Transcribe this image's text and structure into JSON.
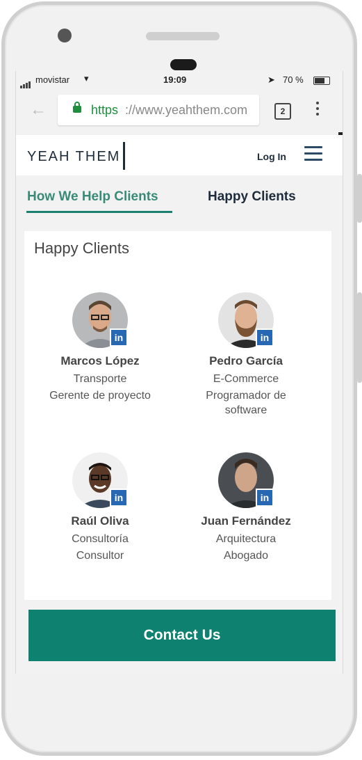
{
  "status_bar": {
    "carrier": "movistar",
    "time": "19:09",
    "battery": "70 %"
  },
  "browser": {
    "url_scheme": "https",
    "url_rest": "://www.yeahthem.com",
    "tab_count": "2"
  },
  "header": {
    "logo": "YEAH THEM",
    "login_label": "Log In"
  },
  "tabs": [
    {
      "label": "How We Help Clients",
      "active": true
    },
    {
      "label": "Happy Clients",
      "active": false
    }
  ],
  "section": {
    "title": "Happy Clients"
  },
  "clients": [
    {
      "name": "Marcos López",
      "industry": "Transporte",
      "role": "Gerente de proyecto"
    },
    {
      "name": "Pedro García",
      "industry": "E-Commerce",
      "role": "Programador de software"
    },
    {
      "name": "Raúl Oliva",
      "industry": "Consultoría",
      "role": "Consultor"
    },
    {
      "name": "Juan Fernández",
      "industry": "Arquitectura",
      "role": "Abogado"
    }
  ],
  "linkedin_badge": "in",
  "cta": {
    "label": "Contact Us"
  },
  "colors": {
    "accent": "#0f8170",
    "navy": "#1d2b3a",
    "linkedin": "#2867b2"
  }
}
